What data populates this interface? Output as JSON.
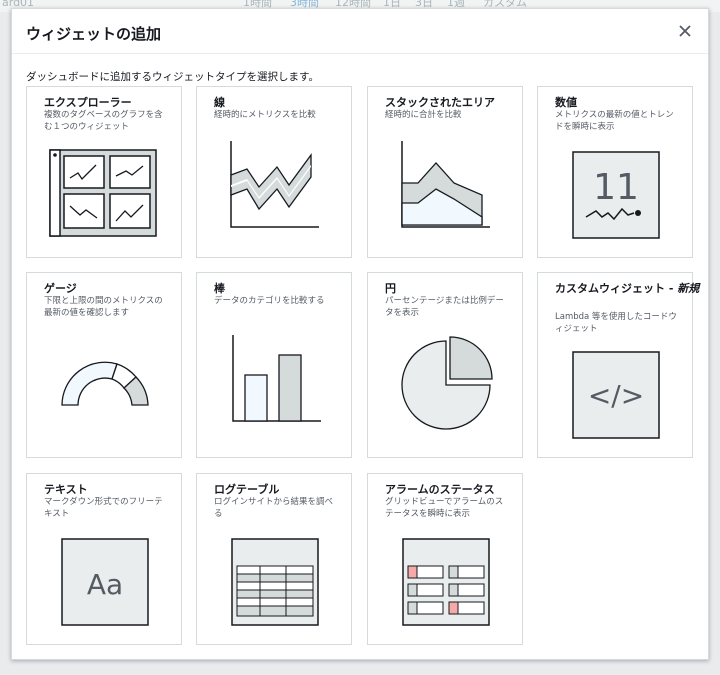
{
  "background": {
    "toolbar_items": [
      "ard01",
      "1時間",
      "3時間",
      "12時間",
      "1日",
      "3日",
      "1週",
      "カスタム"
    ]
  },
  "modal": {
    "title": "ウィジェットの追加",
    "close_icon": "close-icon",
    "instruction": "ダッシュボードに追加するウィジェットタイプを選択します。"
  },
  "widgets": [
    {
      "title": "エクスプローラー",
      "description": "複数のタグベースのグラフを含む１つのウィジェット",
      "icon": "explorer-icon"
    },
    {
      "title": "線",
      "description": "経時的にメトリクスを比較",
      "icon": "line-chart-icon"
    },
    {
      "title": "スタックされたエリア",
      "description": "経時的に合計を比較",
      "icon": "stacked-area-icon"
    },
    {
      "title": "数値",
      "description": "メトリクスの最新の値とトレンドを瞬時に表示",
      "icon": "number-icon",
      "illustration_value": "11"
    },
    {
      "title": "ゲージ",
      "description": "下限と上限の間のメトリクスの最新の値を確認します",
      "icon": "gauge-icon"
    },
    {
      "title": "棒",
      "description": "データのカテゴリを比較する",
      "icon": "bar-chart-icon"
    },
    {
      "title": "円",
      "description": "パーセンテージまたは比例データを表示",
      "icon": "pie-chart-icon"
    },
    {
      "title": "カスタムウィジェット - ",
      "title_new": "新規",
      "description": "Lambda 等を使用したコードウィジェット",
      "icon": "code-icon",
      "illustration_text": "</>"
    },
    {
      "title": "テキスト",
      "description": "マークダウン形式でのフリーテキスト",
      "icon": "text-icon",
      "illustration_text": "Aa"
    },
    {
      "title": "ログテーブル",
      "description": "ログインサイトから結果を調べる",
      "icon": "log-table-icon"
    },
    {
      "title": "アラームのステータス",
      "description": "グリッドビューでアラームのステータスを瞬時に表示",
      "icon": "alarm-status-icon"
    }
  ],
  "colors": {
    "illustration_stroke": "#16191f",
    "illustration_fill": "#d5dbdb",
    "illustration_light": "#f1f8fe",
    "alarm_red": "#f5a9a9"
  }
}
